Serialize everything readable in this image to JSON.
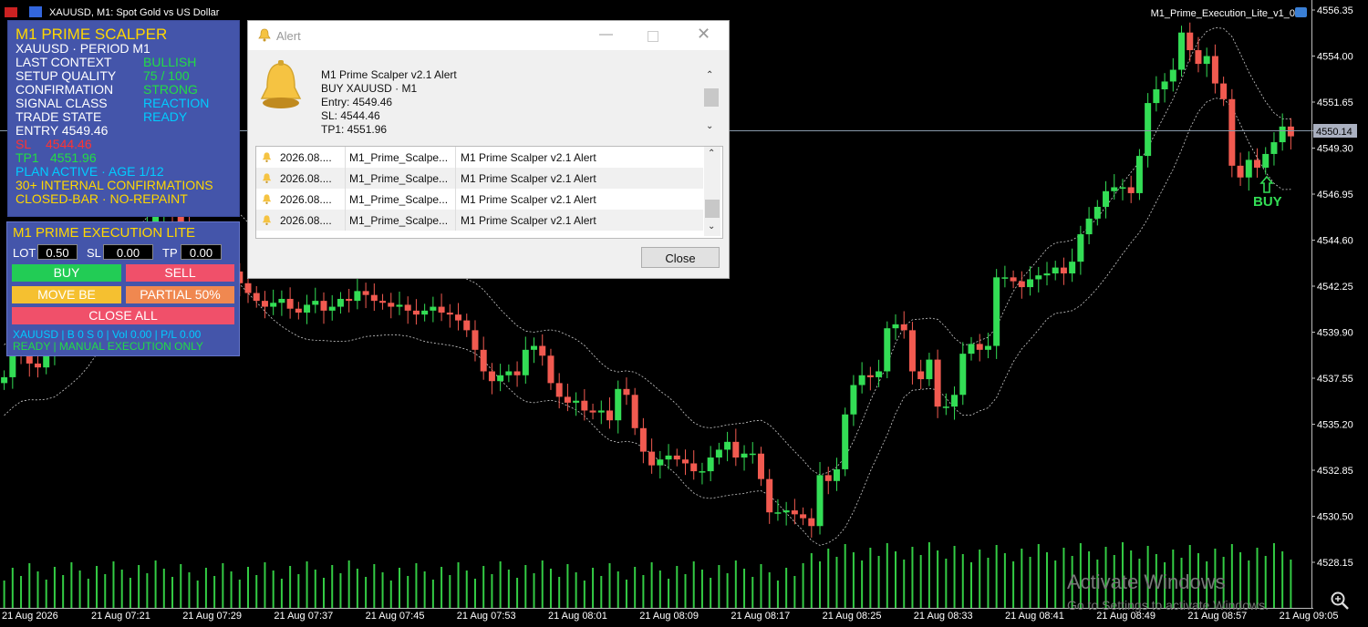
{
  "window": {
    "symbol_title": "XAUUSD, M1:  Spot Gold vs US Dollar",
    "ea_name": "M1_Prime_Execution_Lite_v1_0"
  },
  "scalper_panel": {
    "title": "M1 PRIME SCALPER",
    "rows": [
      {
        "label": "XAUUSD · PERIOD M1",
        "value": ""
      },
      {
        "label": "LAST CONTEXT",
        "value": "BULLISH"
      },
      {
        "label": "SETUP QUALITY",
        "value": "75 / 100"
      },
      {
        "label": "CONFIRMATION",
        "value": "STRONG"
      },
      {
        "label": "SIGNAL CLASS",
        "value": "REACTION"
      },
      {
        "label": "TRADE STATE",
        "value": "READY"
      },
      {
        "label": "ENTRY 4549.46",
        "value": ""
      },
      {
        "label": "SL",
        "value": "4544.46"
      },
      {
        "label": "TP1",
        "value": "4551.96"
      },
      {
        "label": "PLAN ACTIVE · AGE 1/12",
        "value": ""
      },
      {
        "label": "30+ INTERNAL CONFIRMATIONS",
        "value": ""
      },
      {
        "label": "CLOSED-BAR · NO-REPAINT",
        "value": ""
      }
    ],
    "colors": {
      "title": "#ffd700",
      "green": "#22dd44",
      "cyan": "#00ccff",
      "red": "#ff3333",
      "yellow": "#ffd700"
    }
  },
  "exec_panel": {
    "title": "M1 PRIME EXECUTION LITE",
    "lot_label": "LOT",
    "lot_value": "0.50",
    "sl_label": "SL",
    "sl_value": "0.00",
    "tp_label": "TP",
    "tp_value": "0.00",
    "buy": "BUY",
    "sell": "SELL",
    "move_be": "MOVE BE",
    "partial": "PARTIAL 50%",
    "close_all": "CLOSE ALL",
    "status1": "XAUUSD | B 0 S 0 | Vol 0.00 | P/L 0.00",
    "status2": "READY | MANUAL EXECUTION ONLY"
  },
  "alert": {
    "title": "Alert",
    "message": [
      "M1 Prime Scalper v2.1 Alert",
      "BUY XAUUSD · M1",
      "Entry: 4549.46",
      "SL: 4544.46",
      "TP1: 4551.96"
    ],
    "rows": [
      {
        "time": "2026.08....",
        "source": "M1_Prime_Scalpe...",
        "message": "M1 Prime Scalper v2.1 Alert"
      },
      {
        "time": "2026.08....",
        "source": "M1_Prime_Scalpe...",
        "message": "M1 Prime Scalper v2.1 Alert"
      },
      {
        "time": "2026.08....",
        "source": "M1_Prime_Scalpe...",
        "message": "M1 Prime Scalper v2.1 Alert"
      },
      {
        "time": "2026.08....",
        "source": "M1_Prime_Scalpe...",
        "message": "M1 Prime Scalper v2.1 Alert"
      }
    ],
    "close_label": "Close"
  },
  "chart": {
    "price_ticks": [
      "4556.35",
      "4554.00",
      "4551.65",
      "4549.30",
      "4546.95",
      "4544.60",
      "4542.25",
      "4539.90",
      "4537.55",
      "4535.20",
      "4532.85",
      "4530.50",
      "4528.15"
    ],
    "current_price": "4550.14",
    "time_ticks": [
      "21 Aug 2026",
      "21 Aug 07:21",
      "21 Aug 07:29",
      "21 Aug 07:37",
      "21 Aug 07:45",
      "21 Aug 07:53",
      "21 Aug 08:01",
      "21 Aug 08:09",
      "21 Aug 08:17",
      "21 Aug 08:25",
      "21 Aug 08:33",
      "21 Aug 08:41",
      "21 Aug 08:49",
      "21 Aug 08:57",
      "21 Aug 09:05"
    ],
    "buy_signal_label": "BUY",
    "bull_color": "#33dd55",
    "bear_color": "#f15a50",
    "candles_close": [
      4537.6,
      4538.9,
      4538.7,
      4538.3,
      4538.1,
      4538.8,
      4539.4,
      4540.1,
      4541.2,
      4541.8,
      4542.3,
      4542.9,
      4543.5,
      4543.7,
      4544.2,
      4544.6,
      4545.0,
      4545.4,
      4545.8,
      4546.0,
      4545.9,
      4545.5,
      4545.1,
      4544.8,
      4544.5,
      4544.1,
      4543.6,
      4543.0,
      4542.4,
      4541.9,
      4541.5,
      4541.2,
      4541.4,
      4541.6,
      4541.1,
      4540.9,
      4541.3,
      4541.5,
      4541.0,
      4541.2,
      4541.6,
      4541.5,
      4542.0,
      4541.8,
      4541.5,
      4541.4,
      4541.2,
      4541.3,
      4541.0,
      4540.8,
      4541.0,
      4541.2,
      4540.9,
      4540.8,
      4540.5,
      4540.0,
      4539.0,
      4537.9,
      4537.4,
      4537.7,
      4537.9,
      4537.7,
      4539.0,
      4539.2,
      4538.7,
      4537.3,
      4536.6,
      4536.3,
      4536.4,
      4535.9,
      4535.8,
      4535.9,
      4535.4,
      4537.0,
      4536.7,
      4535.0,
      4533.8,
      4533.1,
      4533.4,
      4533.6,
      4533.4,
      4533.2,
      4532.8,
      4532.8,
      4533.5,
      4533.9,
      4534.3,
      4533.5,
      4533.7,
      4533.7,
      4532.4,
      4530.7,
      4530.7,
      4530.8,
      4530.6,
      4530.4,
      4530.0,
      4532.6,
      4532.3,
      4532.9,
      4535.7,
      4537.2,
      4537.7,
      4537.6,
      4537.9,
      4540.1,
      4540.3,
      4540.0,
      4537.9,
      4537.5,
      4538.5,
      4536.1,
      4536.1,
      4536.7,
      4538.8,
      4539.3,
      4539.0,
      4539.2,
      4542.7,
      4542.7,
      4542.5,
      4542.2,
      4542.6,
      4542.8,
      4542.9,
      4543.2,
      4542.9,
      4543.5,
      4544.9,
      4545.7,
      4546.3,
      4547.1,
      4547.3,
      4547.3,
      4547.0,
      4548.9,
      4551.6,
      4552.3,
      4552.7,
      4553.3,
      4555.2,
      4554.3,
      4553.6,
      4554.0,
      4552.6,
      4551.8,
      4548.4,
      4547.8,
      4548.7,
      4548.3,
      4549.0,
      4549.6,
      4550.4,
      4549.9
    ]
  }
}
